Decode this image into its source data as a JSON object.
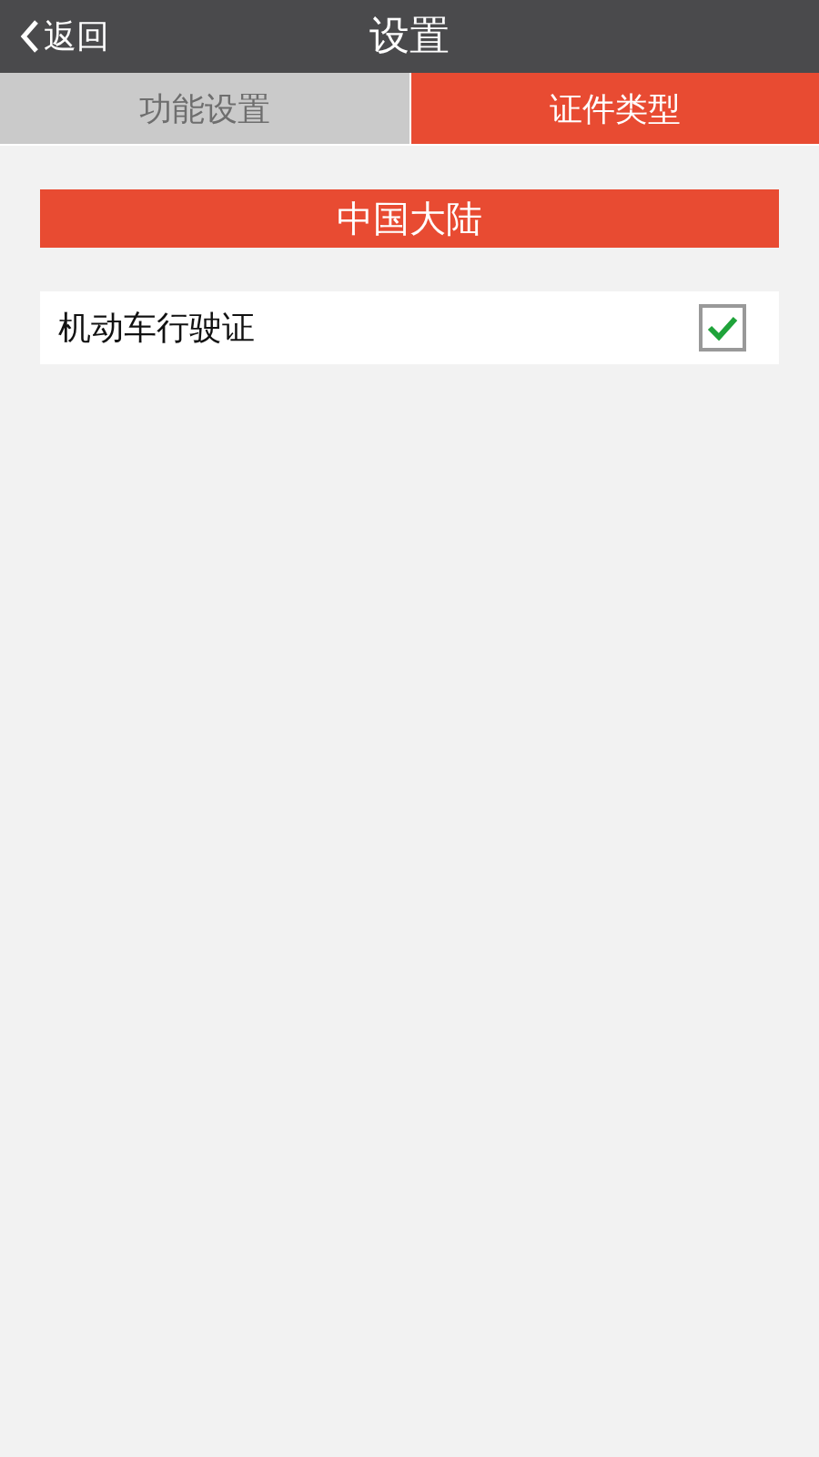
{
  "header": {
    "back": "返回",
    "title": "设置"
  },
  "tabs": [
    {
      "label": "功能设置",
      "selected": false
    },
    {
      "label": "证件类型",
      "selected": true
    }
  ],
  "section": {
    "title": "中国大陆"
  },
  "items": [
    {
      "label": "机动车行驶证",
      "checked": true
    }
  ]
}
